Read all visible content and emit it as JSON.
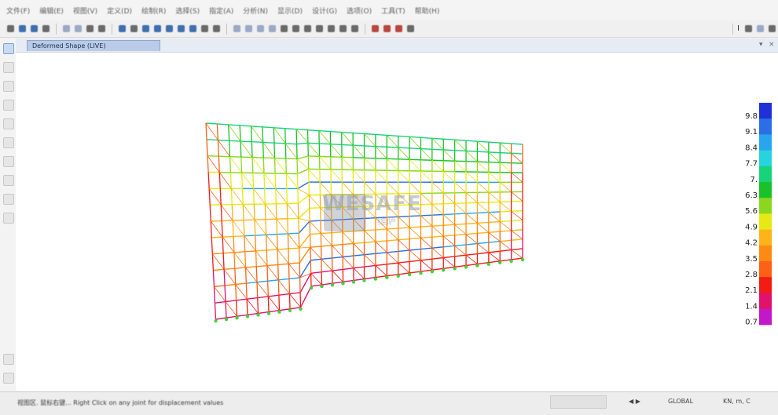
{
  "menubar": {
    "items": [
      "文件(F)",
      "编辑(E)",
      "视图(V)",
      "定义(D)",
      "绘制(R)",
      "选择(S)",
      "指定(A)",
      "分析(N)",
      "显示(D)",
      "设计(G)",
      "选项(O)",
      "工具(T)",
      "帮助(H)"
    ]
  },
  "toolbar": {
    "zoom_dropdown_label": "I",
    "units_dropdown_label": "KN, m, C"
  },
  "tab": {
    "title": "Deformed Shape (LIVE)"
  },
  "legend": {
    "values": [
      "9.8",
      "9.1",
      "8.4",
      "7.7",
      "7.",
      "6.3",
      "5.6",
      "4.9",
      "4.2",
      "3.5",
      "2.8",
      "2.1",
      "1.4",
      "0.7"
    ],
    "colors": [
      "#1f30d8",
      "#2a6fe6",
      "#27a6ef",
      "#25d4dc",
      "#17d37a",
      "#19c22b",
      "#8ad81d",
      "#e6ea12",
      "#ffb31a",
      "#ff8a12",
      "#ff6015",
      "#f31c14",
      "#e0126a",
      "#c318c8"
    ]
  },
  "watermark": {
    "text": "WESAFE",
    "sub": "维萨"
  },
  "status": {
    "message": "视图区. 鼠标右键... Right Click on any joint for displacement values",
    "global_label": "GLOBAL",
    "units": "KN, m, C"
  }
}
